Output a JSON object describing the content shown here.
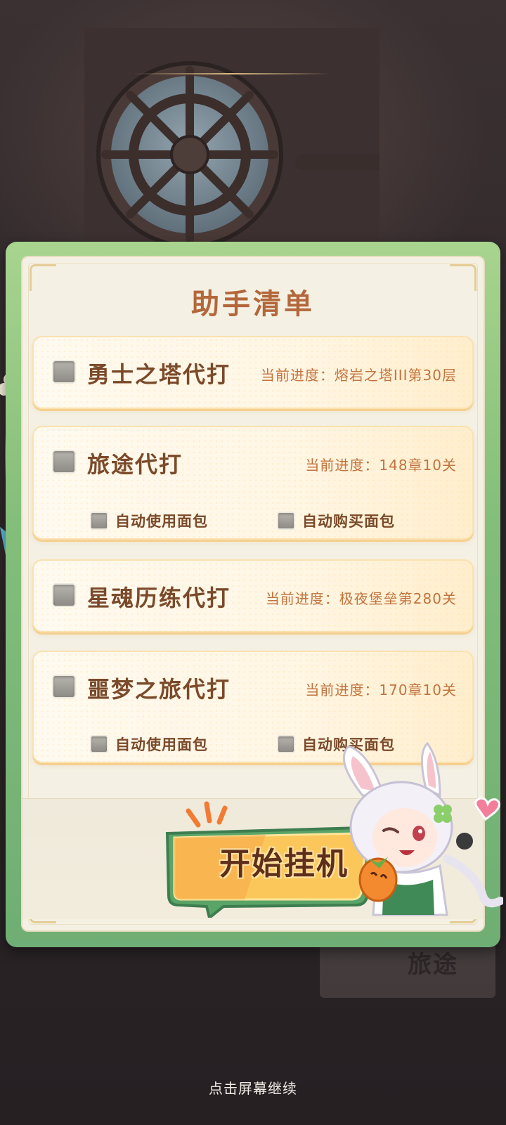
{
  "title": "助手清单",
  "tasks": [
    {
      "name": "勇士之塔代打",
      "progress": "当前进度：熔岩之塔III第30层",
      "checked": false
    },
    {
      "name": "旅途代打",
      "progress": "当前进度：148章10关",
      "checked": false,
      "options": [
        "自动使用面包",
        "自动购买面包"
      ]
    },
    {
      "name": "星魂历练代打",
      "progress": "当前进度：极夜堡垒第280关",
      "checked": false
    },
    {
      "name": "噩梦之旅代打",
      "progress": "当前进度：170章10关",
      "checked": false,
      "options": [
        "自动使用面包",
        "自动购买面包"
      ]
    }
  ],
  "start_button": {
    "label": "开始挂机"
  },
  "continue_hint": "点击屏幕继续",
  "background_poster_text": "旅途",
  "colors": {
    "panel_frame": "#83be7a",
    "title": "#b3673b",
    "task_text": "#7a4a2a",
    "progress_text": "#c2733e",
    "start_button": "#f7b84a"
  }
}
